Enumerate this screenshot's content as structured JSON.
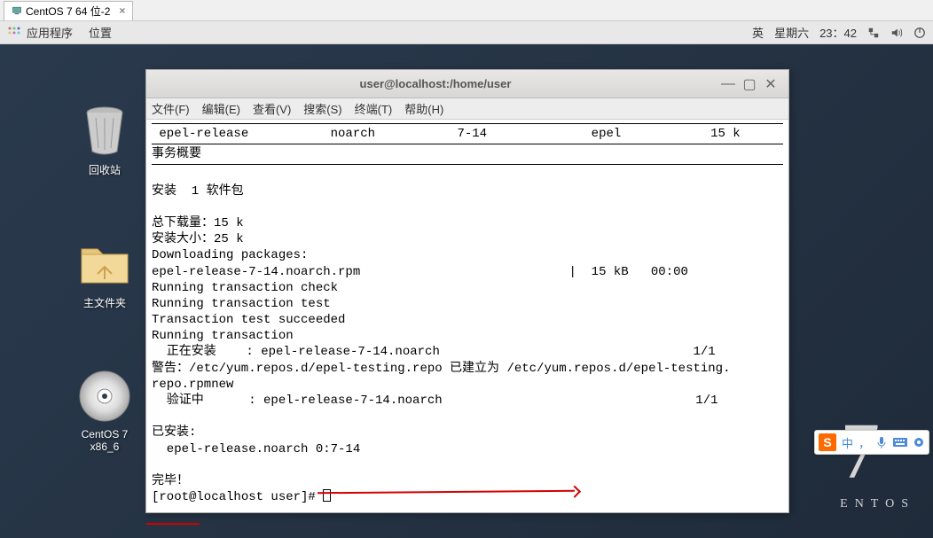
{
  "host": {
    "tab_label": "CentOS 7 64 位-2",
    "tab_close": "×"
  },
  "gnome": {
    "apps": "应用程序",
    "places": "位置",
    "lang": "英",
    "day": "星期六",
    "time": "23：42"
  },
  "desktop_icons": {
    "trash": "回收站",
    "home": "主文件夹",
    "cd": "CentOS 7 x86_6"
  },
  "centos": {
    "num": "7",
    "txt": "ENTOS"
  },
  "terminal": {
    "title": "user@localhost:/home/user",
    "menu": {
      "file": "文件(F)",
      "edit": "编辑(E)",
      "view": "查看(V)",
      "search": "搜索(S)",
      "terminal": "终端(T)",
      "help": "帮助(H)"
    },
    "lines": {
      "l1": " epel-release           noarch           7-14              epel            15 k",
      "l2": "事务概要",
      "l3": "安装  1 软件包",
      "l4": "总下载量：15 k",
      "l5": "安装大小：25 k",
      "l6": "Downloading packages:",
      "l7": "epel-release-7-14.noarch.rpm                            |  15 kB   00:00",
      "l8": "Running transaction check",
      "l9": "Running transaction test",
      "l10": "Transaction test succeeded",
      "l11": "Running transaction",
      "l12": "  正在安装    : epel-release-7-14.noarch                                  1/1",
      "l13": "警告：/etc/yum.repos.d/epel-testing.repo 已建立为 /etc/yum.repos.d/epel-testing.",
      "l14": "repo.rpmnew",
      "l15": "  验证中      : epel-release-7-14.noarch                                  1/1",
      "l16": "已安装:",
      "l17": "  epel-release.noarch 0:7-14",
      "l18": "完毕！",
      "l19": "[root@localhost user]# "
    }
  },
  "ime": {
    "logo": "S",
    "cn": "中"
  }
}
